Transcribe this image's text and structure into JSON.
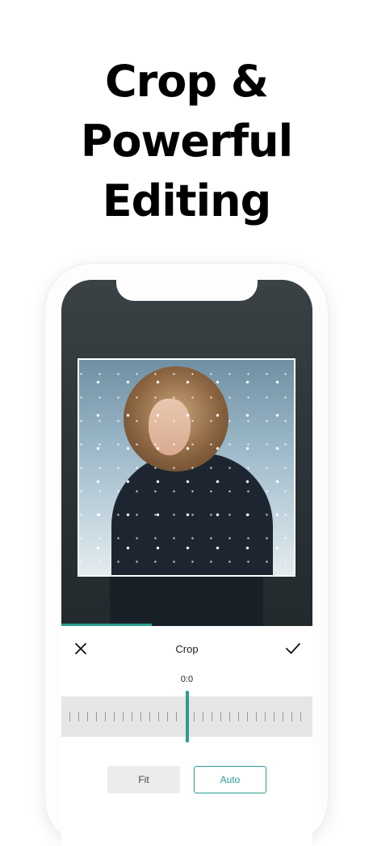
{
  "headline": {
    "line1": "Crop &",
    "line2": "Powerful",
    "line3": "Editing"
  },
  "editor": {
    "toolbar": {
      "title": "Crop",
      "close_icon": "close-icon",
      "confirm_icon": "checkmark-icon"
    },
    "ratio_label": "0:0",
    "buttons": {
      "fit": "Fit",
      "auto": "Auto"
    },
    "accent_color": "#2a9d8f"
  }
}
